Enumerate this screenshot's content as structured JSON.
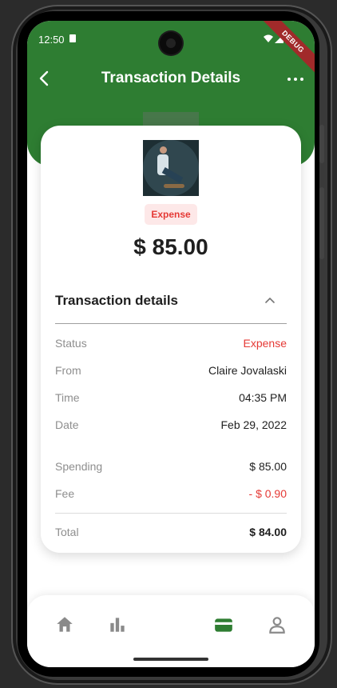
{
  "status_bar": {
    "time": "12:50"
  },
  "debug_banner": "DEBUG",
  "app_bar": {
    "title": "Transaction Details",
    "back_icon": "arrow-back-icon",
    "more_icon": "more-horizontal-icon"
  },
  "colors": {
    "brand_green": "#2e7d32",
    "expense_red": "#e53935",
    "badge_bg": "#fde8e8"
  },
  "transaction": {
    "type_badge": "Expense",
    "amount": "$ 85.00"
  },
  "details": {
    "title": "Transaction details",
    "rows": [
      {
        "label": "Status",
        "value": "Expense"
      },
      {
        "label": "From",
        "value": "Claire Jovalaski"
      },
      {
        "label": "Time",
        "value": "04:35 PM"
      },
      {
        "label": "Date",
        "value": "Feb 29, 2022"
      },
      {
        "label": "Spending",
        "value": "$ 85.00"
      },
      {
        "label": "Fee",
        "value": "- $ 0.90"
      },
      {
        "label": "Total",
        "value": "$ 84.00"
      }
    ]
  },
  "bottom_nav": {
    "items": [
      {
        "icon": "home-icon",
        "active": false
      },
      {
        "icon": "bar-chart-icon",
        "active": false
      },
      {
        "icon": "wallet-icon",
        "active": true
      },
      {
        "icon": "profile-icon",
        "active": false
      }
    ]
  }
}
